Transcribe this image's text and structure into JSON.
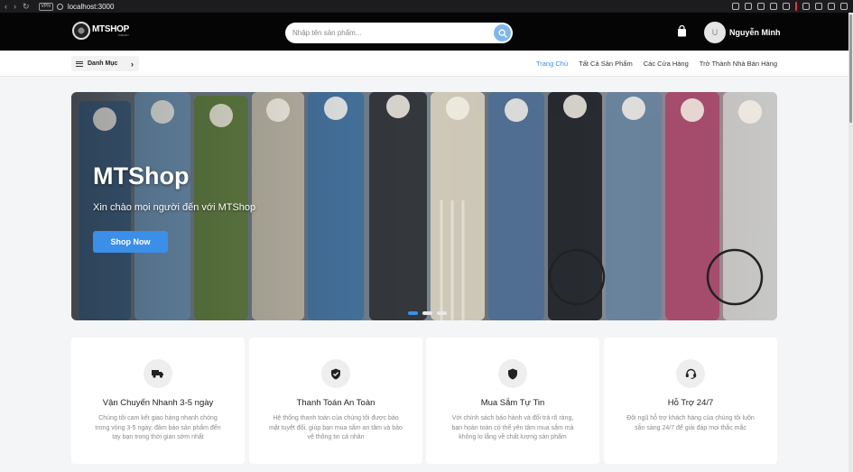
{
  "browser": {
    "nav_back": "‹",
    "nav_forward": "›",
    "nav_reload": "↻",
    "vpn_label": "VPN",
    "url": "localhost:3000"
  },
  "header": {
    "logo_text": "MTSHOP",
    "logo_subtext": "TRENDY",
    "search_placeholder": "Nhập tên sản phẩm...",
    "avatar_initial": "U",
    "user_name": "Nguyễn Minh"
  },
  "subnav": {
    "category_label": "Danh Mục",
    "links": [
      {
        "label": "Trang Chủ",
        "active": true
      },
      {
        "label": "Tất Cả Sản Phẩm",
        "active": false
      },
      {
        "label": "Các Cửa Hàng",
        "active": false
      },
      {
        "label": "Trở Thành Nhà Bán Hàng",
        "active": false
      }
    ]
  },
  "banner": {
    "title": "MTShop",
    "subtitle": "Xin chào mọi người đến với MTShop",
    "cta_label": "Shop Now",
    "slide_count": 3,
    "active_slide": 1
  },
  "features": [
    {
      "icon": "truck-icon",
      "title": "Vận Chuyển Nhanh 3-5 ngày",
      "desc": "Chúng tôi cam kết giao hàng nhanh chóng trong vòng 3-5 ngày, đảm bảo sản phẩm đến tay bạn trong thời gian sớm nhất"
    },
    {
      "icon": "shield-check-icon",
      "title": "Thanh Toán An Toàn",
      "desc": "Hệ thống thanh toán của chúng tôi được bảo mật tuyệt đối, giúp bạn mua sắm an tâm và bảo vệ thông tin cá nhân"
    },
    {
      "icon": "shield-icon",
      "title": "Mua Sắm Tự Tin",
      "desc": "Với chính sách bảo hành và đổi trả rõ ràng, bạn hoàn toàn có thể yên tâm mua sắm mà không lo lắng về chất lượng sản phẩm"
    },
    {
      "icon": "headset-icon",
      "title": "Hỗ Trợ 24/7",
      "desc": "Đội ngũ hỗ trợ khách hàng của chúng tôi luôn sẵn sàng 24/7 để giải đáp mọi thắc mắc"
    }
  ],
  "colors": {
    "accent": "#3b8fe9",
    "header_bg": "#050505",
    "page_bg": "#f4f5f7"
  }
}
